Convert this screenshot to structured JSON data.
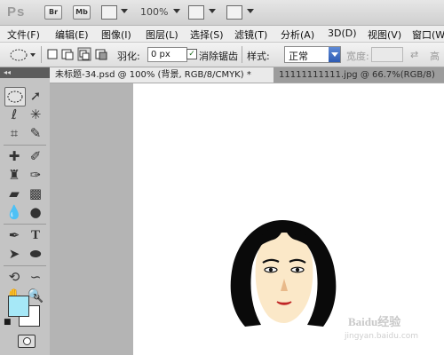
{
  "appbar": {
    "logo": "Ps",
    "br_label": "Br",
    "mb_label": "Mb",
    "zoom": "100%"
  },
  "menubar": {
    "items": [
      "文件(F)",
      "编辑(E)",
      "图像(I)",
      "图层(L)",
      "选择(S)",
      "滤镜(T)",
      "分析(A)",
      "3D(D)",
      "视图(V)",
      "窗口(W)"
    ]
  },
  "options": {
    "feather_label": "羽化:",
    "feather_value": "0 px",
    "antialias_label": "消除锯齿",
    "antialias_checked": true,
    "style_label": "样式:",
    "style_value": "正常",
    "width_label": "宽度:",
    "height_label": "高"
  },
  "tabs": [
    {
      "label": "未标题-34.psd @ 100% (背景, RGB/8/CMYK) *",
      "active": true
    },
    {
      "label": "11111111111.jpg @ 66.7%(RGB/8)",
      "active": false
    }
  ],
  "colors": {
    "foreground": "#a6e8f7",
    "background": "#ffffff",
    "style_arrow": "#2e5bb3"
  },
  "watermark": {
    "line1": "Baidu经验",
    "line2": "jingyan.baidu.com"
  }
}
